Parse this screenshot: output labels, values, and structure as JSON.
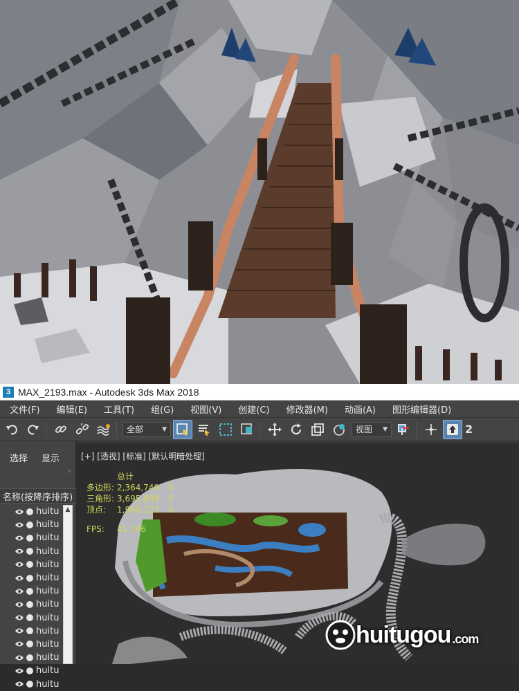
{
  "window": {
    "app_icon_glyph": "3",
    "title": "MAX_2193.max - Autodesk 3ds Max 2018"
  },
  "menu": [
    {
      "label": "文件(F)"
    },
    {
      "label": "编辑(E)"
    },
    {
      "label": "工具(T)"
    },
    {
      "label": "组(G)"
    },
    {
      "label": "视图(V)"
    },
    {
      "label": "创建(C)"
    },
    {
      "label": "修改器(M)"
    },
    {
      "label": "动画(A)"
    },
    {
      "label": "图形编辑器(D)"
    }
  ],
  "toolbar": {
    "selection_filter": "全部",
    "reference_coord": "视图",
    "trailing_number": "2",
    "icons": [
      "undo-icon",
      "redo-icon",
      "link-icon",
      "unlink-icon",
      "bind-spacewarp-icon",
      "select-object-icon",
      "select-by-name-icon",
      "rect-selection-region-icon",
      "window-crossing-icon",
      "move-icon",
      "rotate-icon",
      "scale-icon",
      "placement-icon",
      "pivot-icon",
      "snap-toggle-icon"
    ]
  },
  "explorer": {
    "tabs": [
      "选择",
      "显示"
    ],
    "expand_glyph": "»",
    "column_header": "名称(按降序排序)",
    "rows": [
      "huitu",
      "huitu",
      "huitu",
      "huitu",
      "huitu",
      "huitu",
      "huitu",
      "huitu",
      "huitu",
      "huitu",
      "huitu",
      "huitu",
      "huitu",
      "huitu"
    ]
  },
  "viewport": {
    "label": "[+] [透视] [标准] [默认明暗处理]",
    "stats": {
      "header": "总计",
      "polys_label": "多边形:",
      "polys_value": "2,364,749",
      "polys_sel": "0",
      "tris_label": "三角形:",
      "tris_value": "3,695,898",
      "tris_sel": "0",
      "verts_label": "顶点:",
      "verts_value": "1,960,222",
      "verts_sel": "0",
      "fps_label": "FPS:",
      "fps_value": "41.796"
    }
  },
  "watermark": {
    "text": "huitugou",
    "domain": ".com"
  },
  "colors": {
    "menu_bg": "#444444",
    "viewport_bg": "#2d2d2d",
    "stats_text": "#d2d65a",
    "active_button": "#5c84b0"
  }
}
